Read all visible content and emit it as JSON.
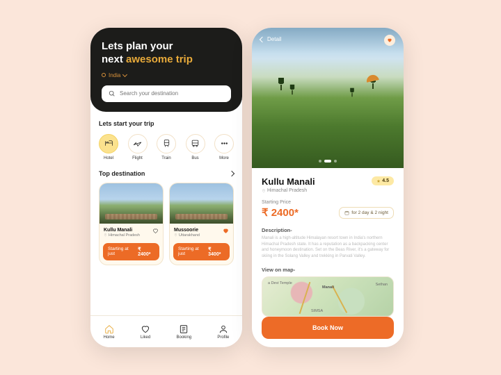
{
  "home": {
    "title_line1": "Lets plan your",
    "title_line2_pre": "next ",
    "title_line2_accent": "awesome trip",
    "location": "India",
    "search_placeholder": "Search your destination",
    "start_label": "Lets start your trip",
    "categories": [
      {
        "label": "Hotel",
        "icon": "bed-icon"
      },
      {
        "label": "Flight",
        "icon": "plane-icon"
      },
      {
        "label": "Train",
        "icon": "train-icon"
      },
      {
        "label": "Bus",
        "icon": "bus-icon"
      },
      {
        "label": "More",
        "icon": "more-icon"
      }
    ],
    "top_label": "Top destination",
    "destinations": [
      {
        "name": "Kullu Manali",
        "region": "Himachal Pradesh",
        "pill_prefix": "Starting at just",
        "price": "₹ 2400*",
        "liked": false
      },
      {
        "name": "Mussoorie",
        "region": "Uttarakhand",
        "pill_prefix": "Starting at just",
        "price": "₹ 3400*",
        "liked": true
      }
    ],
    "nav": [
      {
        "label": "Home",
        "icon": "home-icon"
      },
      {
        "label": "Liked",
        "icon": "heart-icon"
      },
      {
        "label": "Booking",
        "icon": "booking-icon"
      },
      {
        "label": "Profile",
        "icon": "profile-icon"
      }
    ]
  },
  "detail": {
    "back_label": "Detail",
    "name": "Kullu Manali",
    "region": "Himachal Pradesh",
    "rating": "4.5",
    "starting_label": "Starting Price",
    "price": "₹ 2400*",
    "duration": "for 2 day & 2 night",
    "description_heading": "Description-",
    "description": "Manali is a high-altitude Himalayan resort town in India's northern Himachal Pradesh state. It has a reputation as a backpacking center and honeymoon destination. Set on the Beas River, it's a gateway for skiing in the Solang Valley and trekking in Parvati Valley.",
    "map_heading": "View on map-",
    "map_labels": {
      "l1": "a Devi Temple",
      "l2": "Manali",
      "l3": "Sethan",
      "l4": "SIMSA"
    },
    "cta": "Book Now"
  }
}
